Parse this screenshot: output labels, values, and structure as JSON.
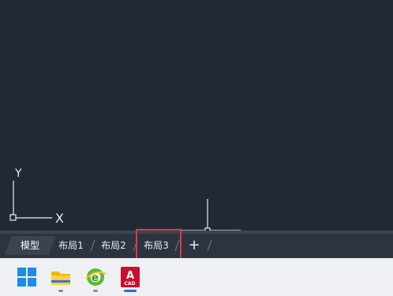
{
  "layout_tabs": {
    "model": "模型",
    "layout1": "布局1",
    "layout2": "布局2",
    "layout3": "布局3",
    "add": "+"
  },
  "ucs": {
    "y_label": "Y",
    "x_label": "X"
  },
  "taskbar": {
    "apps": [
      "windows-start",
      "file-explorer",
      "browser",
      "autocad"
    ],
    "cad_badge": "CAD"
  },
  "colors": {
    "canvas_bg": "#222934",
    "highlight": "#e03a3a",
    "autocad_red": "#c8102e"
  }
}
